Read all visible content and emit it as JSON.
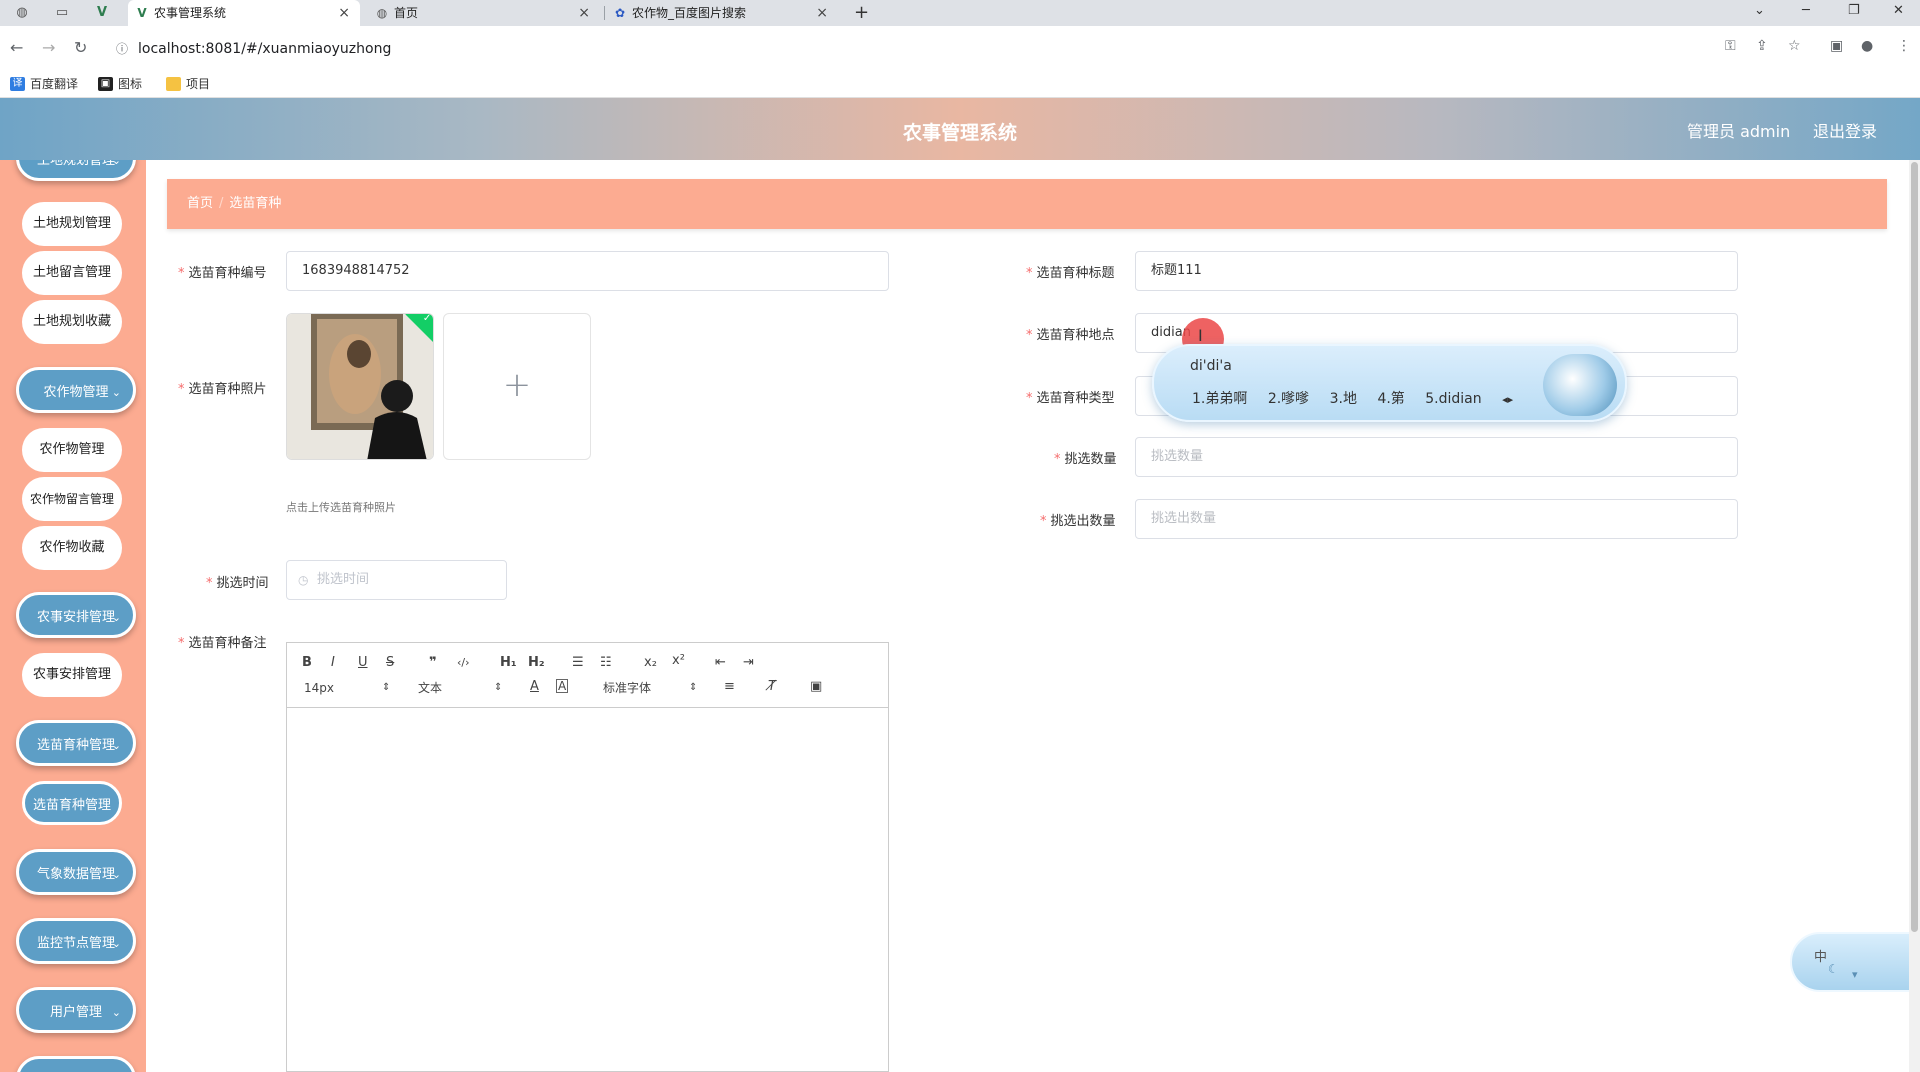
{
  "browser": {
    "tabs": [
      {
        "title": "农事管理系统",
        "active": true
      },
      {
        "title": "首页",
        "active": false
      },
      {
        "title": "农作物_百度图片搜索",
        "active": false
      }
    ],
    "url": "localhost:8081/#/xuanmiaoyuzhong",
    "bookmarks": [
      "百度翻译",
      "图标",
      "项目"
    ]
  },
  "header": {
    "title": "农事管理系统",
    "admin": "管理员 admin",
    "logout": "退出登录"
  },
  "sidebar": {
    "items": [
      {
        "label": "土地规划管理",
        "type": "main"
      },
      {
        "label": "土地规划管理",
        "type": "sub"
      },
      {
        "label": "土地留言管理",
        "type": "sub"
      },
      {
        "label": "土地规划收藏",
        "type": "sub"
      },
      {
        "label": "农作物管理",
        "type": "main"
      },
      {
        "label": "农作物管理",
        "type": "sub"
      },
      {
        "label": "农作物留言管理",
        "type": "sub"
      },
      {
        "label": "农作物收藏",
        "type": "sub"
      },
      {
        "label": "农事安排管理",
        "type": "main"
      },
      {
        "label": "农事安排管理",
        "type": "sub"
      },
      {
        "label": "选苗育种管理",
        "type": "main"
      },
      {
        "label": "选苗育种管理",
        "type": "sub-active"
      },
      {
        "label": "气象数据管理",
        "type": "main"
      },
      {
        "label": "监控节点管理",
        "type": "main"
      },
      {
        "label": "用户管理",
        "type": "main"
      }
    ]
  },
  "breadcrumb": {
    "home": "首页",
    "current": "选苗育种"
  },
  "form": {
    "code_label": "选苗育种编号",
    "code_value": "1683948814752",
    "title_label": "选苗育种标题",
    "title_value": "标题111",
    "photo_label": "选苗育种照片",
    "photo_tip": "点击上传选苗育种照片",
    "upload_plus": "+",
    "location_label": "选苗育种地点",
    "location_value": "didian",
    "type_label": "选苗育种类型",
    "count_label": "挑选数量",
    "count_placeholder": "挑选数量",
    "out_label": "挑选出数量",
    "out_placeholder": "挑选出数量",
    "time_label": "挑选时间",
    "time_placeholder": "挑选时间",
    "remark_label": "选苗育种备注"
  },
  "editor": {
    "font_size": "14px",
    "header_select": "文本",
    "font_family": "标准字体"
  },
  "ime": {
    "composition": "di'di'a",
    "candidates": [
      "1.弟弟啊",
      "2.嗲嗲",
      "3.地",
      "4.第",
      "5.didian"
    ],
    "float_label": "中"
  },
  "colors": {
    "sidebar_bg": "#fcab91",
    "menu_blue": "#5d9ec6",
    "required": "#f56c6c"
  }
}
